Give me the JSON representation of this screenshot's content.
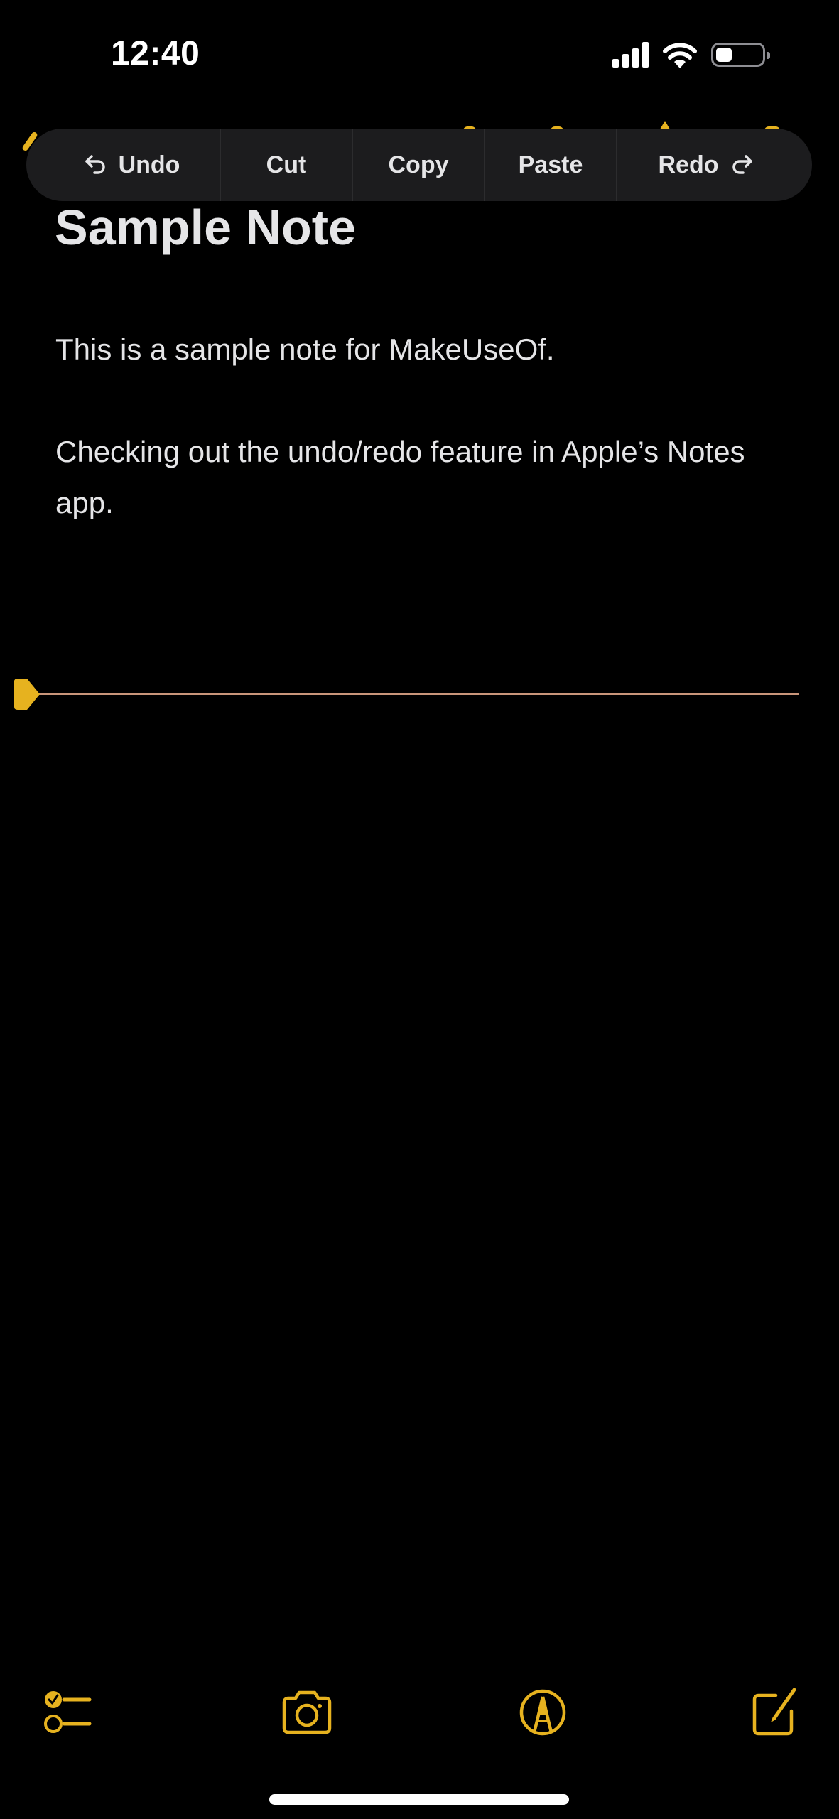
{
  "status_bar": {
    "time": "12:40",
    "icons": [
      "cellular-signal-icon",
      "wifi-icon",
      "battery-icon"
    ]
  },
  "edit_menu": {
    "items": [
      {
        "label": "Undo",
        "icon": "undo-arrow-icon"
      },
      {
        "label": "Cut"
      },
      {
        "label": "Copy"
      },
      {
        "label": "Paste"
      },
      {
        "label": "Redo",
        "icon": "redo-arrow-icon"
      }
    ]
  },
  "note": {
    "title": "Sample Note",
    "paragraphs": [
      "This is a sample note for MakeUseOf.",
      "Checking out the undo/redo feature in Apple’s Notes app."
    ]
  },
  "toolbar": {
    "items": [
      {
        "name": "checklist",
        "icon": "checklist-icon"
      },
      {
        "name": "camera",
        "icon": "camera-icon"
      },
      {
        "name": "markup",
        "icon": "markup-pen-icon"
      },
      {
        "name": "compose",
        "icon": "compose-icon"
      }
    ]
  },
  "colors": {
    "accent": "#e6b21f",
    "background": "#000000",
    "menu_background": "#1c1c1e",
    "text": "#e5e5e7",
    "cursor_line": "#c9957a"
  }
}
